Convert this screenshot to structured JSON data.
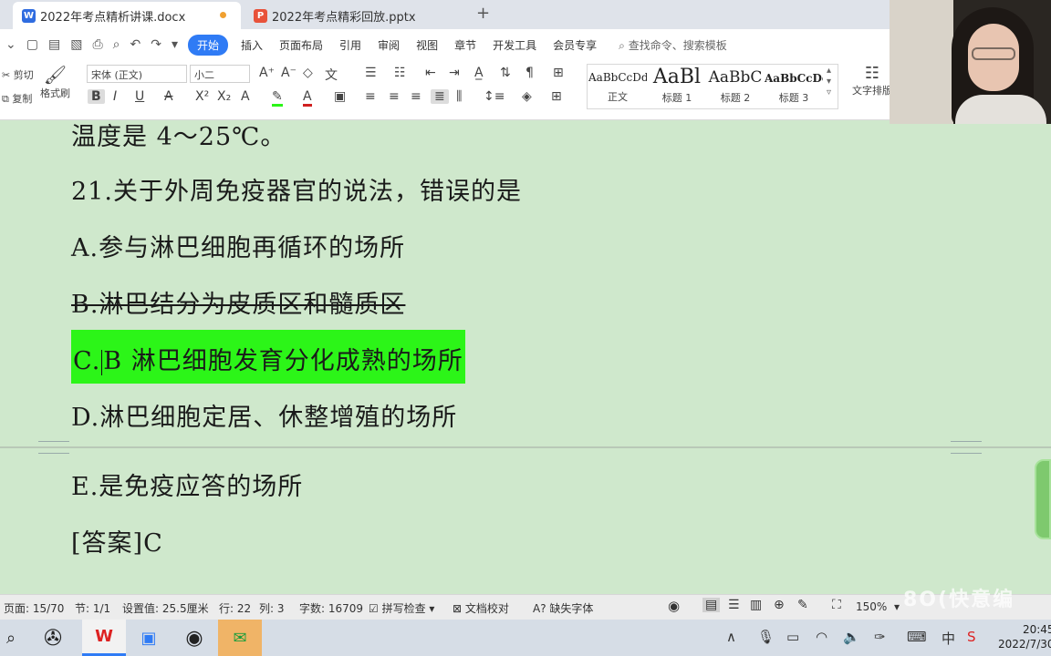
{
  "tabs": [
    {
      "label": "2022年考点精析讲课.docx",
      "icon": "word-file-icon",
      "icon_letter": "W",
      "icon_color": "#2f6ce0"
    },
    {
      "label": "2022年考点精彩回放.pptx",
      "icon": "ppt-file-icon",
      "icon_letter": "P",
      "icon_color": "#e8523a"
    }
  ],
  "menu": {
    "items": [
      "开始",
      "插入",
      "页面布局",
      "引用",
      "审阅",
      "视图",
      "章节",
      "开发工具",
      "会员专享"
    ],
    "active": "开始",
    "search_placeholder": "查找命令、搜索模板"
  },
  "ribbon": {
    "cut": "剪切",
    "copy": "复制",
    "format_painter": "格式刷",
    "font_name": "宋体 (正文)",
    "font_size": "小二",
    "styles": [
      {
        "sample": "AaBbCcDd",
        "name": "正文"
      },
      {
        "sample": "AaBl",
        "name": "标题 1"
      },
      {
        "sample": "AaBbC",
        "name": "标题 2"
      },
      {
        "sample": "AaBbCcDc",
        "name": "标题 3"
      }
    ],
    "text_layout": "文字排版"
  },
  "document": {
    "lines": [
      "温度是 4～25℃。",
      "21.关于外周免疫器官的说法，错误的是",
      "A.参与淋巴细胞再循环的场所",
      "B.淋巴结分为皮质区和髓质区",
      "D.淋巴细胞定居、休整增殖的场所",
      "E.是免疫应答的场所",
      "[答案]C"
    ],
    "option_c_prefix": "C.",
    "option_c_text": "B 淋巴细胞发育分化成熟的场所",
    "highlight_color": "#2cf518"
  },
  "status": {
    "page": "页面: 15/70",
    "section": "节: 1/1",
    "setting": "设置值: 25.5厘米",
    "row": "行: 22",
    "col": "列: 3",
    "words": "字数: 16709",
    "spellcheck": "拼写检查",
    "proofread": "文档校对",
    "missing_font": "缺失字体",
    "zoom": "150%"
  },
  "taskbar": {
    "time": "20:45",
    "date": "2022/7/30"
  },
  "watermark": "8O(快意编"
}
